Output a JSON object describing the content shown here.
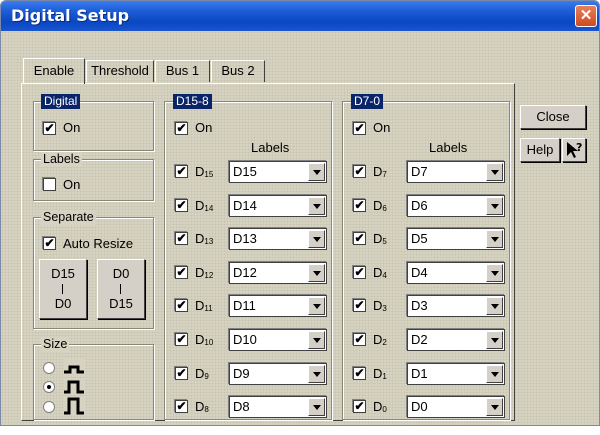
{
  "window": {
    "title": "Digital Setup",
    "close_symbol": "✕"
  },
  "tabs": [
    {
      "label": "Enable",
      "active": true
    },
    {
      "label": "Threshold",
      "active": false
    },
    {
      "label": "Bus 1",
      "active": false
    },
    {
      "label": "Bus 2",
      "active": false
    }
  ],
  "digital": {
    "legend": "Digital",
    "on_label": "On",
    "on_checked": true
  },
  "labels_group": {
    "legend": "Labels",
    "on_label": "On",
    "on_checked": false
  },
  "separate": {
    "legend": "Separate",
    "auto_resize_label": "Auto Resize",
    "auto_resize_checked": true,
    "order_high_to_low": {
      "top": "D15",
      "bottom": "D0"
    },
    "order_low_to_high": {
      "top": "D0",
      "bottom": "D15"
    }
  },
  "size": {
    "legend": "Size",
    "options": [
      "small",
      "medium",
      "large"
    ],
    "selected": 1
  },
  "group_high": {
    "legend": "D15-8",
    "on_label": "On",
    "on_checked": true,
    "labels_header": "Labels",
    "channels": [
      {
        "name": "D",
        "sub": "15",
        "checked": true,
        "label": "D15"
      },
      {
        "name": "D",
        "sub": "14",
        "checked": true,
        "label": "D14"
      },
      {
        "name": "D",
        "sub": "13",
        "checked": true,
        "label": "D13"
      },
      {
        "name": "D",
        "sub": "12",
        "checked": true,
        "label": "D12"
      },
      {
        "name": "D",
        "sub": "11",
        "checked": true,
        "label": "D11"
      },
      {
        "name": "D",
        "sub": "10",
        "checked": true,
        "label": "D10"
      },
      {
        "name": "D",
        "sub": "9",
        "checked": true,
        "label": "D9"
      },
      {
        "name": "D",
        "sub": "8",
        "checked": true,
        "label": "D8"
      }
    ]
  },
  "group_low": {
    "legend": "D7-0",
    "on_label": "On",
    "on_checked": true,
    "labels_header": "Labels",
    "channels": [
      {
        "name": "D",
        "sub": "7",
        "checked": true,
        "label": "D7"
      },
      {
        "name": "D",
        "sub": "6",
        "checked": true,
        "label": "D6"
      },
      {
        "name": "D",
        "sub": "5",
        "checked": true,
        "label": "D5"
      },
      {
        "name": "D",
        "sub": "4",
        "checked": true,
        "label": "D4"
      },
      {
        "name": "D",
        "sub": "3",
        "checked": true,
        "label": "D3"
      },
      {
        "name": "D",
        "sub": "2",
        "checked": true,
        "label": "D2"
      },
      {
        "name": "D",
        "sub": "1",
        "checked": true,
        "label": "D1"
      },
      {
        "name": "D",
        "sub": "0",
        "checked": true,
        "label": "D0"
      }
    ]
  },
  "buttons": {
    "close": "Close",
    "help": "Help",
    "whats_this_icon": "pointer-question-icon"
  },
  "check_mark": "✔",
  "colors": {
    "title_bar": "#0a47c2",
    "legend_highlight": "#0a246a",
    "dialog_bg": "#d6d3c2",
    "close_button": "#cf4a20"
  }
}
